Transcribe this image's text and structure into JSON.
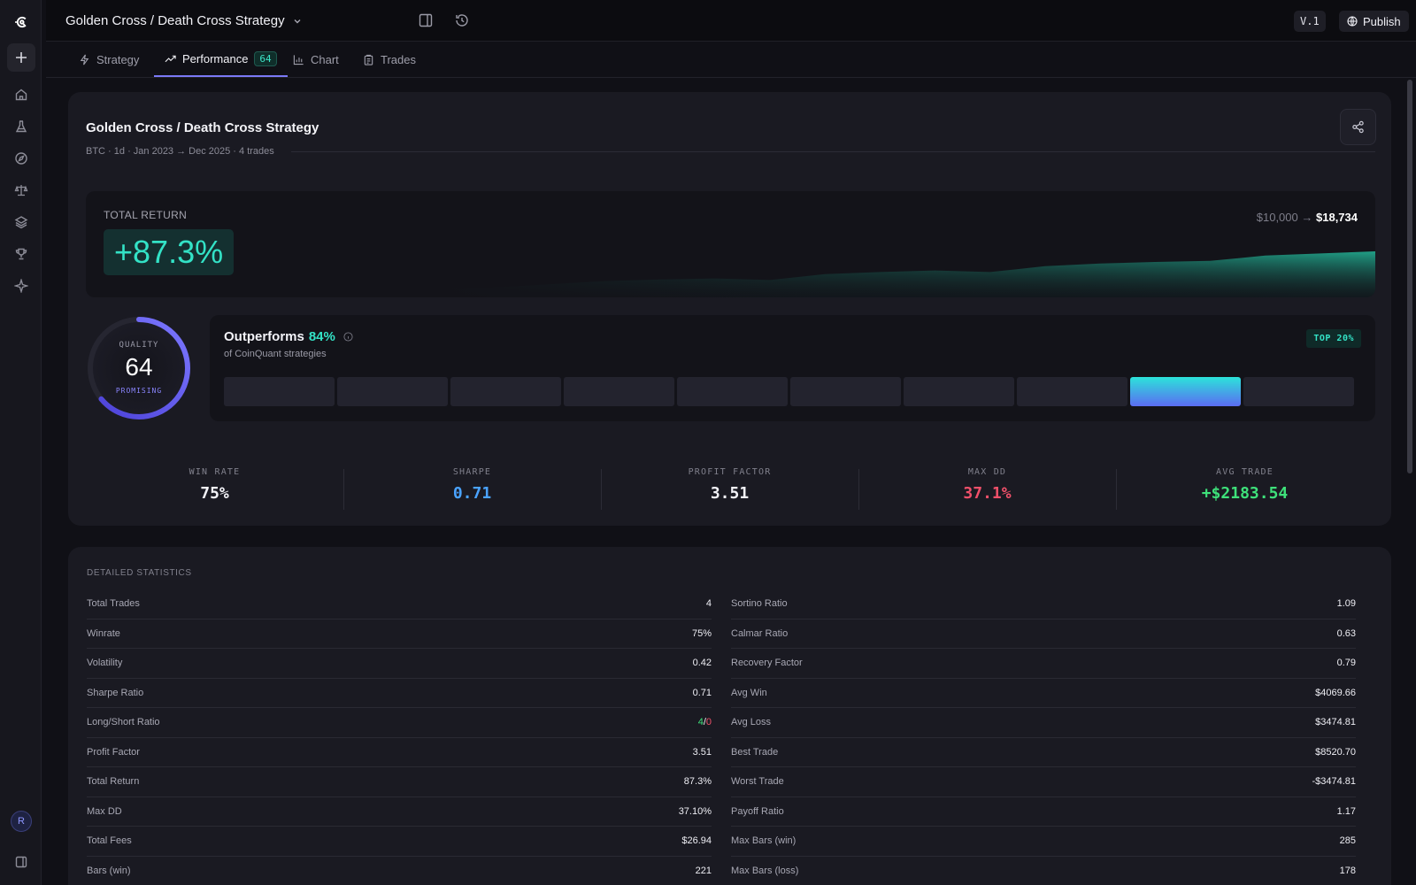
{
  "header": {
    "doc_title": "Golden Cross / Death Cross Strategy",
    "version": "V.1",
    "publish_label": "Publish"
  },
  "tabs": [
    {
      "label": "Strategy"
    },
    {
      "label": "Performance",
      "badge": "64"
    },
    {
      "label": "Chart"
    },
    {
      "label": "Trades"
    }
  ],
  "summary": {
    "title": "Golden Cross / Death Cross Strategy",
    "subtitle": "BTC · 1d · Jan 2023 → Dec 2025 · 4 trades",
    "total_return_label": "TOTAL RETURN",
    "total_return": "+87.3%",
    "start_equity": "$10,000",
    "arrow": "→",
    "end_equity": "$18,734",
    "equity_fraction": [
      0.0,
      0.02,
      0.08,
      0.14,
      0.17,
      0.19,
      0.16,
      0.27,
      0.31,
      0.34,
      0.31,
      0.42,
      0.47,
      0.5,
      0.52,
      0.62,
      0.66,
      0.7
    ]
  },
  "quality": {
    "label": "QUALITY",
    "score": "64",
    "rating": "PROMISING",
    "fraction": 0.64
  },
  "outperform": {
    "prefix": "Outperforms",
    "percent": "84%",
    "subtitle": "of CoinQuant strategies",
    "badge": "TOP 20%",
    "bins": 10,
    "highlight_bin": 9
  },
  "stats": [
    {
      "label": "WIN RATE",
      "value": "75%",
      "color": "#f2f2f7"
    },
    {
      "label": "SHARPE",
      "value": "0.71",
      "color": "#4aa3ff"
    },
    {
      "label": "PROFIT FACTOR",
      "value": "3.51",
      "color": "#f2f2f7"
    },
    {
      "label": "MAX DD",
      "value": "37.1%",
      "color": "#f0506a"
    },
    {
      "label": "AVG TRADE",
      "value": "+$2183.54",
      "color": "#3ee07a"
    }
  ],
  "detailed": {
    "label": "DETAILED STATISTICS",
    "left": [
      {
        "k": "Total Trades",
        "v": "4"
      },
      {
        "k": "Winrate",
        "v": "75%"
      },
      {
        "k": "Volatility",
        "v": "0.42"
      },
      {
        "k": "Sharpe Ratio",
        "v": "0.71"
      },
      {
        "k": "Long/Short Ratio",
        "v_long": "4",
        "v_sep": "/",
        "v_short": "0"
      },
      {
        "k": "Profit Factor",
        "v": "3.51"
      },
      {
        "k": "Total Return",
        "v": "87.3%",
        "tone": "g"
      },
      {
        "k": "Max DD",
        "v": "37.10%",
        "tone": "r"
      },
      {
        "k": "Total Fees",
        "v": "$26.94",
        "tone": "g"
      },
      {
        "k": "Bars (win)",
        "v": "221"
      }
    ],
    "right": [
      {
        "k": "Sortino Ratio",
        "v": "1.09"
      },
      {
        "k": "Calmar Ratio",
        "v": "0.63"
      },
      {
        "k": "Recovery Factor",
        "v": "0.79",
        "tone": "r"
      },
      {
        "k": "Avg Win",
        "v": "$4069.66",
        "tone": "g"
      },
      {
        "k": "Avg Loss",
        "v": "$3474.81",
        "tone": "r"
      },
      {
        "k": "Best Trade",
        "v": "$8520.70",
        "tone": "g"
      },
      {
        "k": "Worst Trade",
        "v": "-$3474.81",
        "tone": "r"
      },
      {
        "k": "Payoff Ratio",
        "v": "1.17"
      },
      {
        "k": "Max Bars (win)",
        "v": "285"
      },
      {
        "k": "Max Bars (loss)",
        "v": "178"
      }
    ]
  },
  "user": {
    "initial": "R"
  }
}
